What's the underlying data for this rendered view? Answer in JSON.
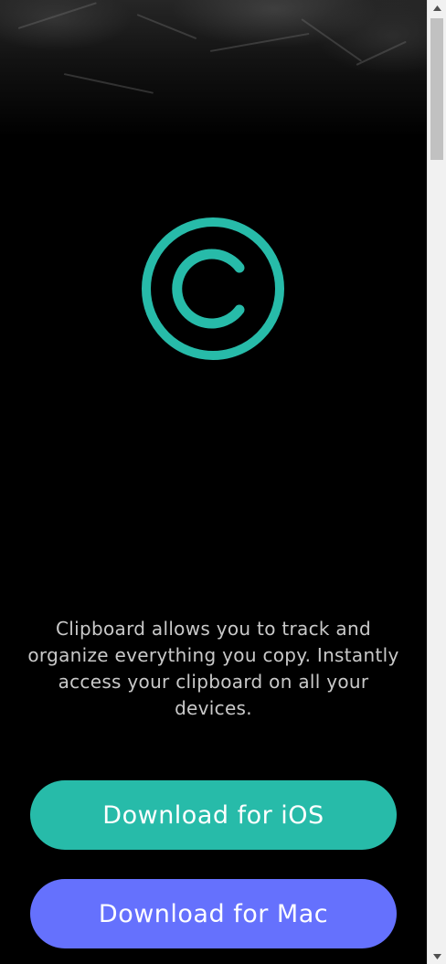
{
  "app": {
    "logo_icon": "clipboard-copyright-c-icon",
    "accent_color": "#27bba9"
  },
  "main": {
    "description": "Clipboard allows you to track and organize everything you copy. Instantly access your clipboard on all your devices."
  },
  "buttons": {
    "ios_label": "Download for iOS",
    "ios_color": "#27bba9",
    "mac_label": "Download for Mac",
    "mac_color": "#6571fd"
  },
  "scrollbar": {
    "up_icon": "triangle-up-icon",
    "down_icon": "triangle-down-icon"
  }
}
